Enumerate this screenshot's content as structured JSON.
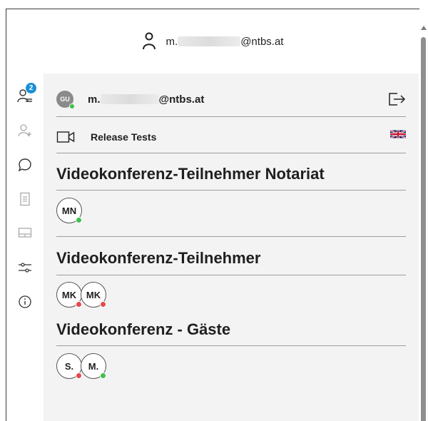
{
  "account": {
    "email_prefix": "m.",
    "email_domain": "@ntbs.at"
  },
  "rail": {
    "notification_count": "2"
  },
  "me": {
    "initials": "GU",
    "email_prefix": "m.",
    "email_domain": "@ntbs.at",
    "status": "online"
  },
  "room": {
    "label": "Release Tests",
    "language": "English (UK flag)"
  },
  "sections": [
    {
      "title": "Videokonferenz-Teilnehmer Notariat",
      "participants": [
        {
          "initials": "MN",
          "status": "online"
        }
      ]
    },
    {
      "title": "Videokonferenz-Teilnehmer",
      "participants": [
        {
          "initials": "MK",
          "status": "offline"
        },
        {
          "initials": "MK",
          "status": "offline"
        }
      ]
    },
    {
      "title": "Videokonferenz - Gäste",
      "participants": [
        {
          "initials": "S.",
          "status": "offline"
        },
        {
          "initials": "M.",
          "status": "online"
        }
      ]
    }
  ],
  "colors": {
    "online": "#3fbf4e",
    "offline": "#e8474c",
    "badge": "#1a8fd6",
    "panel_bg": "#f3f3f3"
  }
}
